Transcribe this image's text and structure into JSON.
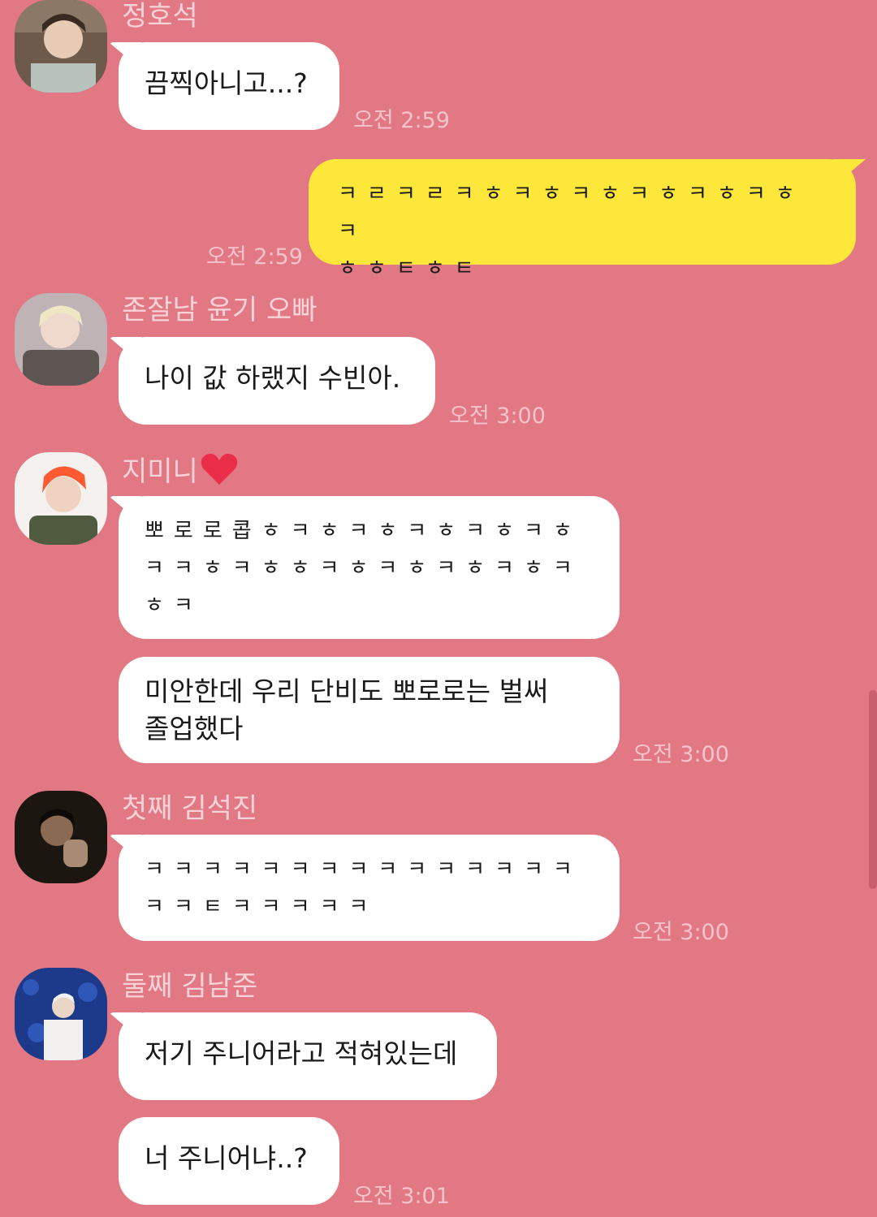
{
  "chat": {
    "messages": [
      {
        "sender": "정호석",
        "bubbles": [
          "끔찍아니고...?"
        ],
        "time": "오전 2:59"
      },
      {
        "sender": "me",
        "bubbles": [
          "ㅋㄹㅋㄹㅋㅎㅋㅎㅋㅎㅋㅎㅋㅎㅋㅎㅋ\nㅎㅎㅌㅎㅌ"
        ],
        "time": "오전 2:59"
      },
      {
        "sender": "존잘남 윤기 오빠",
        "bubbles": [
          "나이 값 하랬지 수빈아."
        ],
        "time": "오전 3:00"
      },
      {
        "sender": "지미니",
        "sender_emoji": "heart-icon",
        "bubbles": [
          "뽀로로콥ㅎㅋㅎㅋㅎㅋㅎㅋㅎㅋㅎ\nㅋㅋㅎㅋㅎㅎㅋㅎㅋㅎㅋㅎㅋㅎㅋ\nㅎㅋ",
          "미안한데 우리 단비도 뽀로로는 벌써\n졸업했다"
        ],
        "time": "오전 3:00"
      },
      {
        "sender": "첫째 김석진",
        "bubbles": [
          "ㅋㅋㅋㅋㅋㅋㅋㅋㅋㅋㅋㅋㅋㅋㅋ\nㅋㅋㅌㅋㅋㅋㅋㅋ"
        ],
        "time": "오전 3:00"
      },
      {
        "sender": "둘째 김남준",
        "bubbles": [
          "저기 주니어라고 적혀있는데",
          "너 주니어냐..?"
        ],
        "time": "오전 3:01"
      }
    ]
  },
  "colors": {
    "background": "#e27884",
    "my_bubble": "#fee73b",
    "their_bubble": "#ffffff",
    "name_text": "#f7d3d7",
    "time_text": "#f5c4ca"
  }
}
